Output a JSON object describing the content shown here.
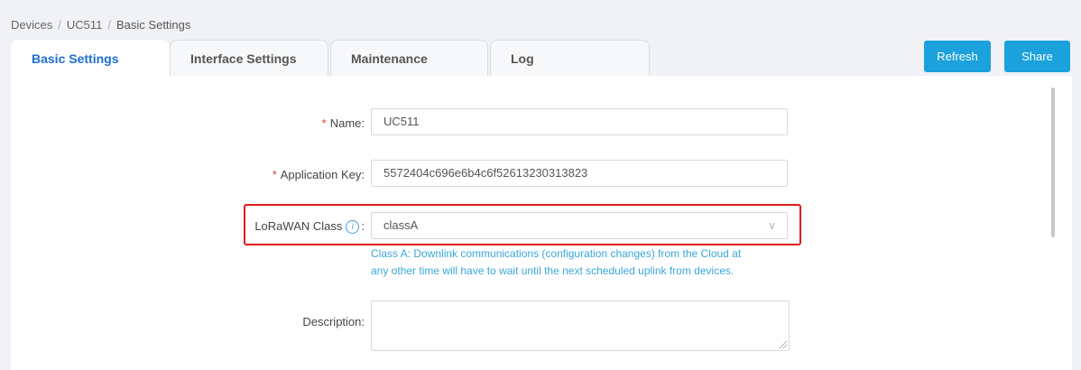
{
  "breadcrumb": {
    "root": "Devices",
    "device": "UC511",
    "page": "Basic Settings"
  },
  "tabs": [
    {
      "label": "Basic Settings"
    },
    {
      "label": "Interface Settings"
    },
    {
      "label": "Maintenance"
    },
    {
      "label": "Log"
    }
  ],
  "buttons": {
    "refresh": "Refresh",
    "share": "Share"
  },
  "form": {
    "name": {
      "label": "Name:",
      "value": "UC511"
    },
    "app_key": {
      "label": "Application Key:",
      "value": "5572404c696e6b4c6f52613230313823"
    },
    "lorawan_class": {
      "label": "LoRaWAN Class",
      "colon": ":",
      "info_icon": "i",
      "value": "classA",
      "hint_line1": "Class A: Downlink communications (configuration changes) from the Cloud at",
      "hint_line2": "any other time will have to wait until the next scheduled uplink from devices."
    },
    "description": {
      "label": "Description:",
      "value": ""
    }
  },
  "colors": {
    "accent": "#1ba1dc",
    "active_tab": "#1c6fd1",
    "required": "#e23b3b",
    "highlight": "#e21b1b"
  }
}
